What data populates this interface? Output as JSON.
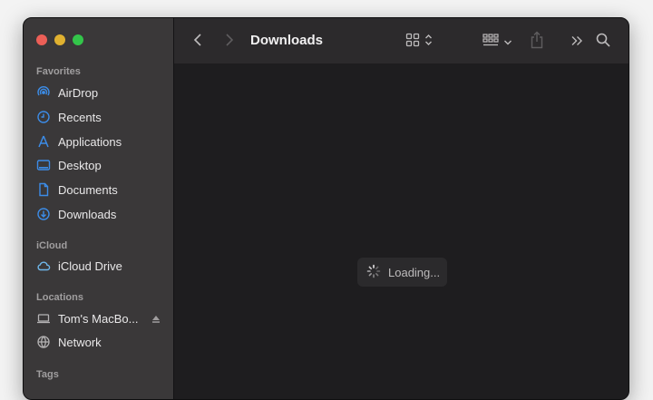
{
  "window": {
    "title": "Downloads"
  },
  "sidebar": {
    "sections": {
      "favorites": "Favorites",
      "icloud": "iCloud",
      "locations": "Locations",
      "tags": "Tags"
    },
    "favorites": [
      {
        "label": "AirDrop",
        "icon": "airdrop-icon"
      },
      {
        "label": "Recents",
        "icon": "clock-icon"
      },
      {
        "label": "Applications",
        "icon": "applications-icon"
      },
      {
        "label": "Desktop",
        "icon": "desktop-icon"
      },
      {
        "label": "Documents",
        "icon": "document-icon"
      },
      {
        "label": "Downloads",
        "icon": "download-icon"
      }
    ],
    "icloud": [
      {
        "label": "iCloud Drive",
        "icon": "cloud-icon"
      }
    ],
    "locations": [
      {
        "label": "Tom's MacBo...",
        "icon": "laptop-icon"
      },
      {
        "label": "Network",
        "icon": "globe-icon"
      }
    ]
  },
  "main": {
    "loading_text": "Loading..."
  },
  "colors": {
    "accent": "#3c8ce7",
    "sidebar_bg": "#3a3839",
    "content_bg": "#1e1d1f"
  }
}
